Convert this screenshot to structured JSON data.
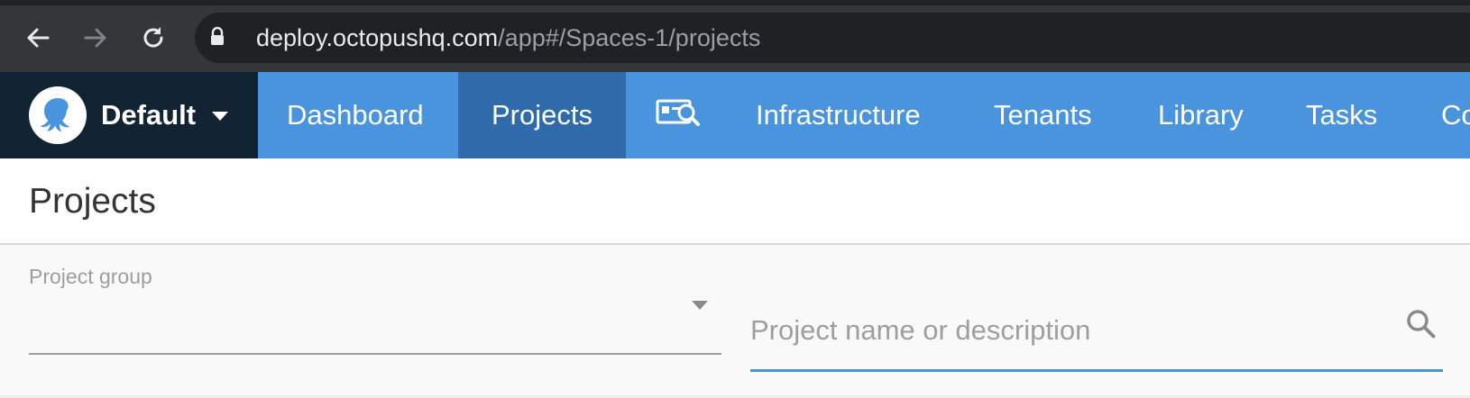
{
  "browser": {
    "url_host": "deploy.octopushq.com",
    "url_path": "/app#/Spaces-1/projects",
    "icons": [
      "back-arrow-icon",
      "forward-arrow-icon",
      "reload-icon",
      "lock-icon"
    ]
  },
  "app_nav": {
    "space": {
      "name": "Default",
      "logo_icon": "octopus-logo-icon",
      "caret_icon": "caret-down-icon"
    },
    "items": [
      {
        "label": "Dashboard",
        "active": false
      },
      {
        "label": "Projects",
        "active": true
      },
      {
        "label": "",
        "icon": "search-card-icon",
        "active": false
      },
      {
        "label": "Infrastructure",
        "active": false
      },
      {
        "label": "Tenants",
        "active": false
      },
      {
        "label": "Library",
        "active": false
      },
      {
        "label": "Tasks",
        "active": false
      },
      {
        "label": "Co",
        "active": false
      }
    ],
    "colors": {
      "nav_bg": "#4a94dd",
      "active_bg": "#2f6aab",
      "space_bg": "#122334"
    }
  },
  "page": {
    "title": "Projects"
  },
  "filters": {
    "project_group": {
      "label": "Project group",
      "value": ""
    },
    "search": {
      "placeholder": "Project name or description",
      "value": "",
      "icon": "search-icon"
    }
  }
}
